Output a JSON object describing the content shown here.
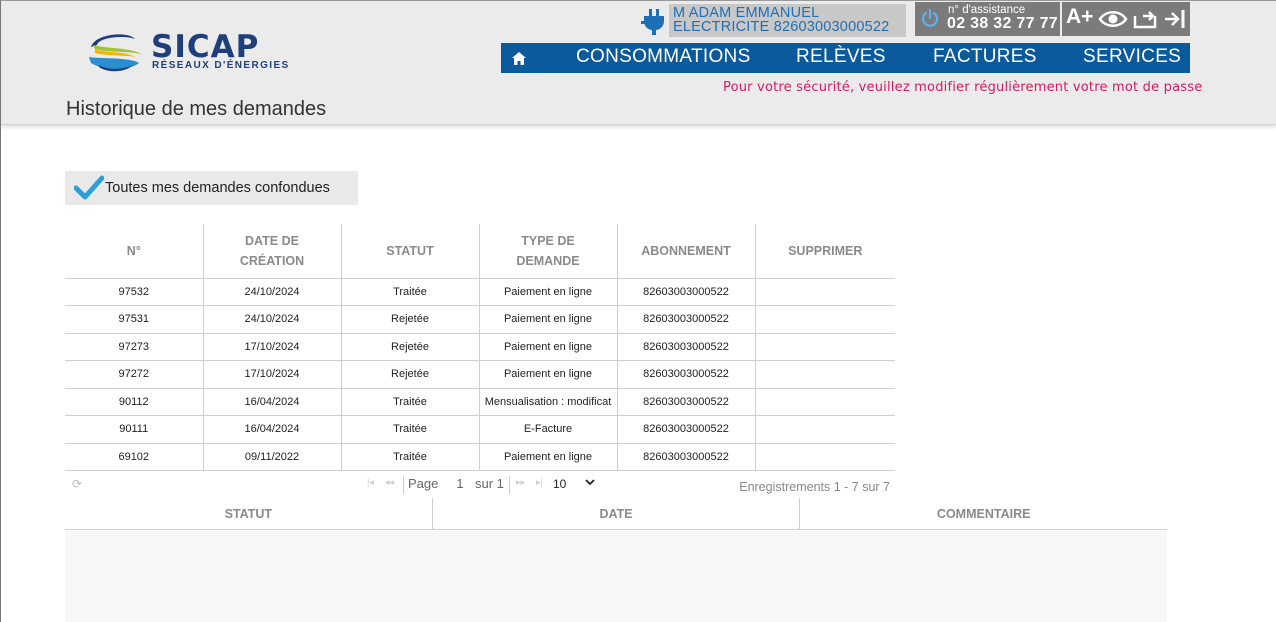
{
  "brand": {
    "name": "SICAP",
    "tagline": "RÉSEAUX D'ÉNERGIES",
    "colors": {
      "navy": "#1f3f7a",
      "accent_blue": "#0a5a9c",
      "alert_pink": "#d81b60"
    }
  },
  "user": {
    "name": "M ADAM EMMANUEL",
    "contract": "ELECTRICITE 82603003000522"
  },
  "assistance": {
    "label": "n° d'assistance",
    "number": "02 38 32 77 77"
  },
  "tools": {
    "font_increase": "A+",
    "icons": [
      "eye-icon",
      "contrast-swap-icon",
      "logout-icon"
    ]
  },
  "nav": {
    "home_icon": "home-icon",
    "items": [
      {
        "label": "CONSOMMATIONS"
      },
      {
        "label": "RELÈVES"
      },
      {
        "label": "FACTURES"
      },
      {
        "label": "SERVICES"
      }
    ]
  },
  "security_message": "Pour votre sécurité, veuillez modifier régulièrement votre mot de passe",
  "page_title": "Historique de mes demandes",
  "filter": {
    "label": "Toutes mes demandes confondues"
  },
  "table": {
    "headers": [
      {
        "line1": "N°",
        "line2": ""
      },
      {
        "line1": "DATE DE",
        "line2": "CRÉATION"
      },
      {
        "line1": "STATUT",
        "line2": ""
      },
      {
        "line1": "TYPE DE",
        "line2": "DEMANDE"
      },
      {
        "line1": "ABONNEMENT",
        "line2": ""
      },
      {
        "line1": "SUPPRIMER",
        "line2": ""
      }
    ],
    "rows": [
      {
        "num": "97532",
        "date": "24/10/2024",
        "status": "Traitée",
        "type": "Paiement en ligne",
        "subscription": "82603003000522",
        "delete": ""
      },
      {
        "num": "97531",
        "date": "24/10/2024",
        "status": "Rejetée",
        "type": "Paiement en ligne",
        "subscription": "82603003000522",
        "delete": ""
      },
      {
        "num": "97273",
        "date": "17/10/2024",
        "status": "Rejetée",
        "type": "Paiement en ligne",
        "subscription": "82603003000522",
        "delete": ""
      },
      {
        "num": "97272",
        "date": "17/10/2024",
        "status": "Rejetée",
        "type": "Paiement en ligne",
        "subscription": "82603003000522",
        "delete": ""
      },
      {
        "num": "90112",
        "date": "16/04/2024",
        "status": "Traitée",
        "type": "Mensualisation : modificat",
        "subscription": "82603003000522",
        "delete": ""
      },
      {
        "num": "90111",
        "date": "16/04/2024",
        "status": "Traitée",
        "type": "E-Facture",
        "subscription": "82603003000522",
        "delete": ""
      },
      {
        "num": "69102",
        "date": "09/11/2022",
        "status": "Traitée",
        "type": "Paiement en ligne",
        "subscription": "82603003000522",
        "delete": ""
      }
    ]
  },
  "pager": {
    "page_label": "Page",
    "page_value": "1",
    "of_label": "sur 1",
    "page_size": "10",
    "records": "Enregistrements 1 - 7 sur 7"
  },
  "subgrid": {
    "headers": [
      "STATUT",
      "DATE",
      "COMMENTAIRE"
    ]
  }
}
